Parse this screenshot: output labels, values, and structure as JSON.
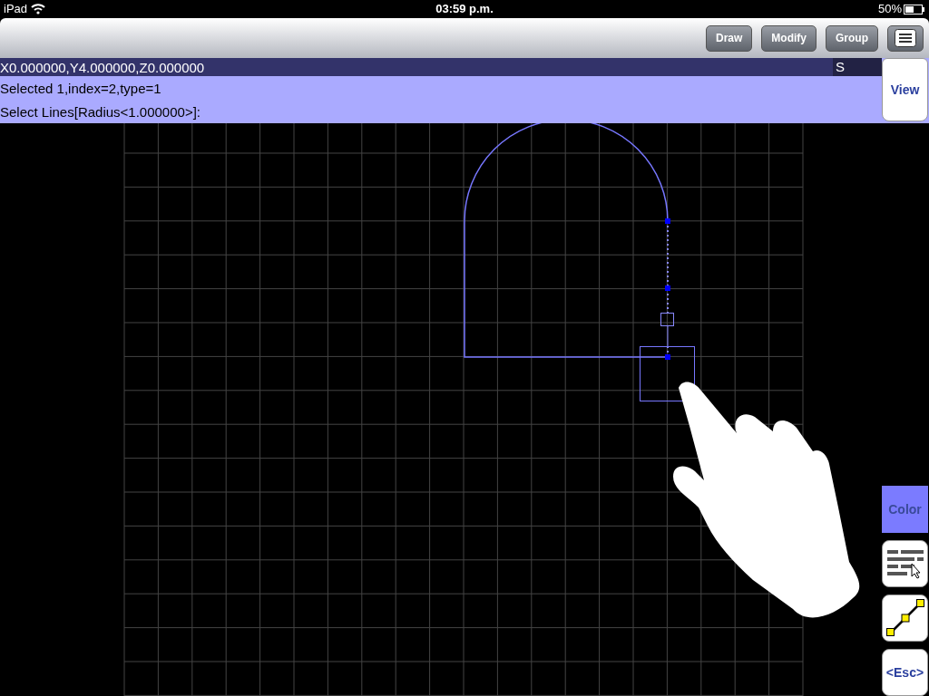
{
  "status_bar": {
    "carrier": "iPad",
    "time": "03:59 p.m.",
    "battery": "50%"
  },
  "toolbar": {
    "buttons": [
      "Draw",
      "Modify",
      "Group"
    ]
  },
  "coordinate_bar": {
    "coordinates": "X0.000000,Y4.000000,Z0.000000",
    "snap": "S"
  },
  "messages": [
    "Selected 1,index=2,type=1",
    "Select Lines[Radius<1.000000>]:"
  ],
  "view_button": "View",
  "side_buttons": [
    {
      "kind": "text",
      "label": "Color",
      "selected": true
    },
    {
      "kind": "layers",
      "selected": false
    },
    {
      "kind": "line",
      "selected": false
    },
    {
      "kind": "text",
      "label": "<Esc>",
      "selected": false
    }
  ]
}
